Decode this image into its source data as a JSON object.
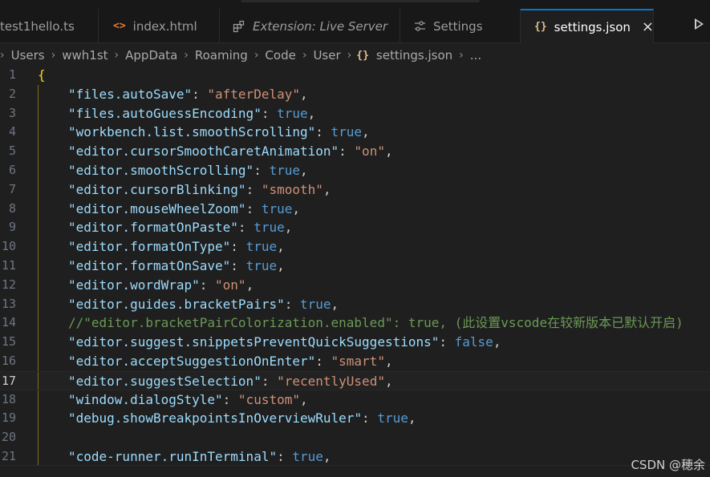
{
  "tabs": [
    {
      "label": "test1hello.ts",
      "icon": "typescript-file-icon",
      "active": false,
      "italic": false
    },
    {
      "label": "index.html",
      "icon": "html-file-icon",
      "active": false,
      "italic": false
    },
    {
      "label": "Extension: Live Server",
      "icon": "extensions-icon",
      "active": false,
      "italic": true
    },
    {
      "label": "Settings",
      "icon": "settings-sliders-icon",
      "active": false,
      "italic": false
    },
    {
      "label": "settings.json",
      "icon": "json-file-icon",
      "active": true,
      "italic": false
    }
  ],
  "icons": {
    "html": "<>",
    "json": "{}",
    "close": "×",
    "breadcrumb_separator": "›"
  },
  "breadcrumb": [
    "Users",
    "wwh1st",
    "AppData",
    "Roaming",
    "Code",
    "User",
    "settings.json",
    "..."
  ],
  "editor": {
    "current_line": 17,
    "lines": [
      {
        "n": "1",
        "tokens": [
          {
            "t": "{",
            "c": "brace"
          }
        ]
      },
      {
        "n": "2",
        "tokens": [
          {
            "t": "\"files.autoSave\"",
            "c": "key"
          },
          {
            "t": ": ",
            "c": "punct"
          },
          {
            "t": "\"afterDelay\"",
            "c": "str"
          },
          {
            "t": ",",
            "c": "punct"
          }
        ]
      },
      {
        "n": "3",
        "tokens": [
          {
            "t": "\"files.autoGuessEncoding\"",
            "c": "key"
          },
          {
            "t": ": ",
            "c": "punct"
          },
          {
            "t": "true",
            "c": "bool"
          },
          {
            "t": ",",
            "c": "punct"
          }
        ]
      },
      {
        "n": "4",
        "tokens": [
          {
            "t": "\"workbench.list.smoothScrolling\"",
            "c": "key"
          },
          {
            "t": ": ",
            "c": "punct"
          },
          {
            "t": "true",
            "c": "bool"
          },
          {
            "t": ",",
            "c": "punct"
          }
        ]
      },
      {
        "n": "5",
        "tokens": [
          {
            "t": "\"editor.cursorSmoothCaretAnimation\"",
            "c": "key"
          },
          {
            "t": ": ",
            "c": "punct"
          },
          {
            "t": "\"on\"",
            "c": "str"
          },
          {
            "t": ",",
            "c": "punct"
          }
        ]
      },
      {
        "n": "6",
        "tokens": [
          {
            "t": "\"editor.smoothScrolling\"",
            "c": "key"
          },
          {
            "t": ": ",
            "c": "punct"
          },
          {
            "t": "true",
            "c": "bool"
          },
          {
            "t": ",",
            "c": "punct"
          }
        ]
      },
      {
        "n": "7",
        "tokens": [
          {
            "t": "\"editor.cursorBlinking\"",
            "c": "key"
          },
          {
            "t": ": ",
            "c": "punct"
          },
          {
            "t": "\"smooth\"",
            "c": "str"
          },
          {
            "t": ",",
            "c": "punct"
          }
        ]
      },
      {
        "n": "8",
        "tokens": [
          {
            "t": "\"editor.mouseWheelZoom\"",
            "c": "key"
          },
          {
            "t": ": ",
            "c": "punct"
          },
          {
            "t": "true",
            "c": "bool"
          },
          {
            "t": ",",
            "c": "punct"
          }
        ]
      },
      {
        "n": "9",
        "tokens": [
          {
            "t": "\"editor.formatOnPaste\"",
            "c": "key"
          },
          {
            "t": ": ",
            "c": "punct"
          },
          {
            "t": "true",
            "c": "bool"
          },
          {
            "t": ",",
            "c": "punct"
          }
        ]
      },
      {
        "n": "10",
        "tokens": [
          {
            "t": "\"editor.formatOnType\"",
            "c": "key"
          },
          {
            "t": ": ",
            "c": "punct"
          },
          {
            "t": "true",
            "c": "bool"
          },
          {
            "t": ",",
            "c": "punct"
          }
        ]
      },
      {
        "n": "11",
        "tokens": [
          {
            "t": "\"editor.formatOnSave\"",
            "c": "key"
          },
          {
            "t": ": ",
            "c": "punct"
          },
          {
            "t": "true",
            "c": "bool"
          },
          {
            "t": ",",
            "c": "punct"
          }
        ]
      },
      {
        "n": "12",
        "tokens": [
          {
            "t": "\"editor.wordWrap\"",
            "c": "key"
          },
          {
            "t": ": ",
            "c": "punct"
          },
          {
            "t": "\"on\"",
            "c": "str"
          },
          {
            "t": ",",
            "c": "punct"
          }
        ]
      },
      {
        "n": "13",
        "tokens": [
          {
            "t": "\"editor.guides.bracketPairs\"",
            "c": "key"
          },
          {
            "t": ": ",
            "c": "punct"
          },
          {
            "t": "true",
            "c": "bool"
          },
          {
            "t": ",",
            "c": "punct"
          }
        ]
      },
      {
        "n": "14",
        "tokens": [
          {
            "t": "//\"editor.bracketPairColorization.enabled\": true, (此设置vscode在较新版本已默认开启)",
            "c": "comment"
          }
        ]
      },
      {
        "n": "15",
        "tokens": [
          {
            "t": "\"editor.suggest.snippetsPreventQuickSuggestions\"",
            "c": "key"
          },
          {
            "t": ": ",
            "c": "punct"
          },
          {
            "t": "false",
            "c": "bool"
          },
          {
            "t": ",",
            "c": "punct"
          }
        ]
      },
      {
        "n": "16",
        "tokens": [
          {
            "t": "\"editor.acceptSuggestionOnEnter\"",
            "c": "key"
          },
          {
            "t": ": ",
            "c": "punct"
          },
          {
            "t": "\"smart\"",
            "c": "str"
          },
          {
            "t": ",",
            "c": "punct"
          }
        ]
      },
      {
        "n": "17",
        "tokens": [
          {
            "t": "\"editor.suggestSelection\"",
            "c": "key"
          },
          {
            "t": ": ",
            "c": "punct"
          },
          {
            "t": "\"recentlyUsed\"",
            "c": "str"
          },
          {
            "t": ",",
            "c": "punct"
          }
        ]
      },
      {
        "n": "18",
        "tokens": [
          {
            "t": "\"window.dialogStyle\"",
            "c": "key"
          },
          {
            "t": ": ",
            "c": "punct"
          },
          {
            "t": "\"custom\"",
            "c": "str"
          },
          {
            "t": ",",
            "c": "punct"
          }
        ]
      },
      {
        "n": "19",
        "tokens": [
          {
            "t": "\"debug.showBreakpointsInOverviewRuler\"",
            "c": "key"
          },
          {
            "t": ": ",
            "c": "punct"
          },
          {
            "t": "true",
            "c": "bool"
          },
          {
            "t": ",",
            "c": "punct"
          }
        ]
      },
      {
        "n": "20",
        "tokens": []
      },
      {
        "n": "21",
        "tokens": [
          {
            "t": "\"code-runner.runInTerminal\"",
            "c": "key"
          },
          {
            "t": ": ",
            "c": "punct"
          },
          {
            "t": "true",
            "c": "bool"
          },
          {
            "t": ",",
            "c": "punct"
          }
        ]
      }
    ]
  },
  "watermark": "CSDN @穂余",
  "colors": {
    "accent": "#0078d4",
    "key": "#9cdcfe",
    "string": "#ce9178",
    "boolean": "#569cd6",
    "comment": "#6a9955",
    "brace": "#ffd700",
    "json_icon": "#e2c08d",
    "html_icon": "#e37933"
  }
}
